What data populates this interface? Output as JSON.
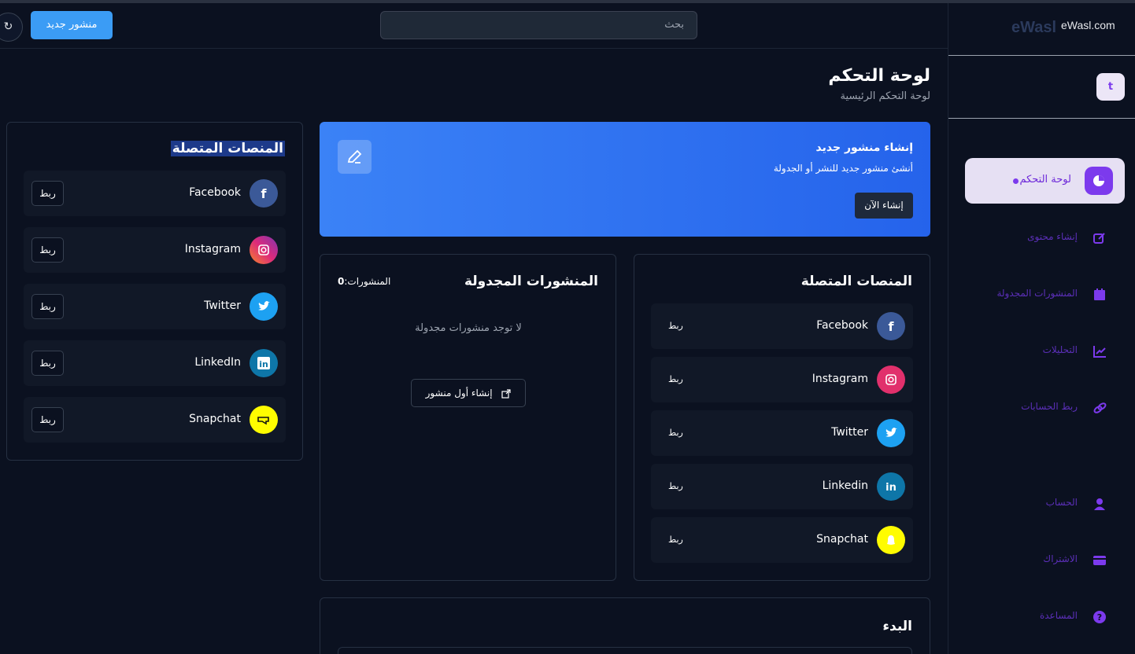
{
  "header": {
    "search_placeholder": "بحث",
    "new_post_button": "منشور جديد",
    "refresh_icon": "↻"
  },
  "sidebar": {
    "logo_text": "eWasl",
    "logo_alt": "eWasl.com",
    "avatar_initial": "t",
    "active_item": "لوحة التحكم",
    "items": [
      {
        "label": "إنشاء محتوى",
        "icon": "edit-icon"
      },
      {
        "label": "المنشورات المجدولة",
        "icon": "calendar-icon"
      },
      {
        "label": "التحليلات",
        "icon": "chart-line-icon"
      },
      {
        "label": "ربط الحسابات",
        "icon": "link-icon"
      },
      {
        "label": "الحساب",
        "icon": "user-icon"
      },
      {
        "label": "الاشتراك",
        "icon": "credit-card-icon"
      },
      {
        "label": "المساعدة",
        "icon": "help-icon"
      }
    ],
    "accent": "#7c3aed"
  },
  "page": {
    "title": "لوحة التحكم",
    "subtitle": "لوحة التحكم الرئيسية"
  },
  "hero": {
    "title": "إنشاء منشور جديد",
    "subtitle": "أنشئ منشور جديد للنشر أو الجدولة",
    "button": "إنشاء الآن"
  },
  "scheduled": {
    "title": "المنشورات المجدولة",
    "count_label": "المنشورات:",
    "count": "0",
    "empty": "لا توجد منشورات مجدولة",
    "button": "إنشاء أول منشور"
  },
  "connected_main": {
    "title": "المنصات المتصلة",
    "link_label": "ربط",
    "platforms": [
      "Facebook",
      "Instagram",
      "Twitter",
      "Linkedin",
      "Snapchat"
    ]
  },
  "connected_side": {
    "title": "المنصات المتصلة",
    "link_label": "ربط",
    "platforms": [
      "Facebook",
      "Instagram",
      "Twitter",
      "LinkedIn",
      "Snapchat"
    ]
  },
  "getting_started": {
    "title": "البدء"
  }
}
